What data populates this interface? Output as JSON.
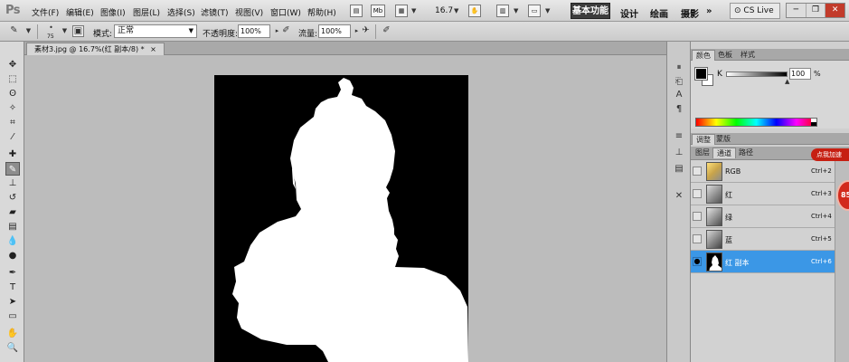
{
  "app": {
    "logo": "Ps"
  },
  "menu": {
    "items": [
      "文件(F)",
      "编辑(E)",
      "图像(I)",
      "图层(L)",
      "选择(S)",
      "滤镜(T)",
      "视图(V)",
      "窗口(W)",
      "帮助(H)"
    ],
    "mb_label": "Mb",
    "zoom": "16.7",
    "workspaces": {
      "active": "基本功能",
      "others": [
        "设计",
        "绘画",
        "摄影"
      ],
      "more": "»"
    },
    "cslive": "CS Live"
  },
  "options": {
    "brush_size": "75",
    "mode_label": "模式:",
    "mode_value": "正常",
    "opacity_label": "不透明度:",
    "opacity_value": "100%",
    "flow_label": "流量:",
    "flow_value": "100%"
  },
  "document": {
    "tab_title": "素材3.jpg @ 16.7%(红 副本/8) *"
  },
  "color_panel": {
    "tabs": [
      "颜色",
      "色板",
      "样式"
    ],
    "channel_label": "K",
    "value": "100",
    "unit": "%",
    "fg_color": "#000000",
    "bg_color": "#ffffff"
  },
  "adjust_tabs": [
    "调整",
    "蒙版"
  ],
  "channel_tabs": [
    "图层",
    "通道",
    "路径"
  ],
  "channels": [
    {
      "name": "RGB",
      "shortcut": "Ctrl+2",
      "visible": false,
      "selected": false
    },
    {
      "name": "红",
      "shortcut": "Ctrl+3",
      "visible": false,
      "selected": false
    },
    {
      "name": "绿",
      "shortcut": "Ctrl+4",
      "visible": false,
      "selected": false
    },
    {
      "name": "蓝",
      "shortcut": "Ctrl+5",
      "visible": false,
      "selected": false
    },
    {
      "name": "红 副本",
      "shortcut": "Ctrl+6",
      "visible": true,
      "selected": true
    }
  ],
  "overlay": {
    "badge": "点我加速",
    "percent": "85"
  },
  "colors": {
    "selection": "#3b97e6",
    "workspace_active": "#3d3d3d"
  }
}
